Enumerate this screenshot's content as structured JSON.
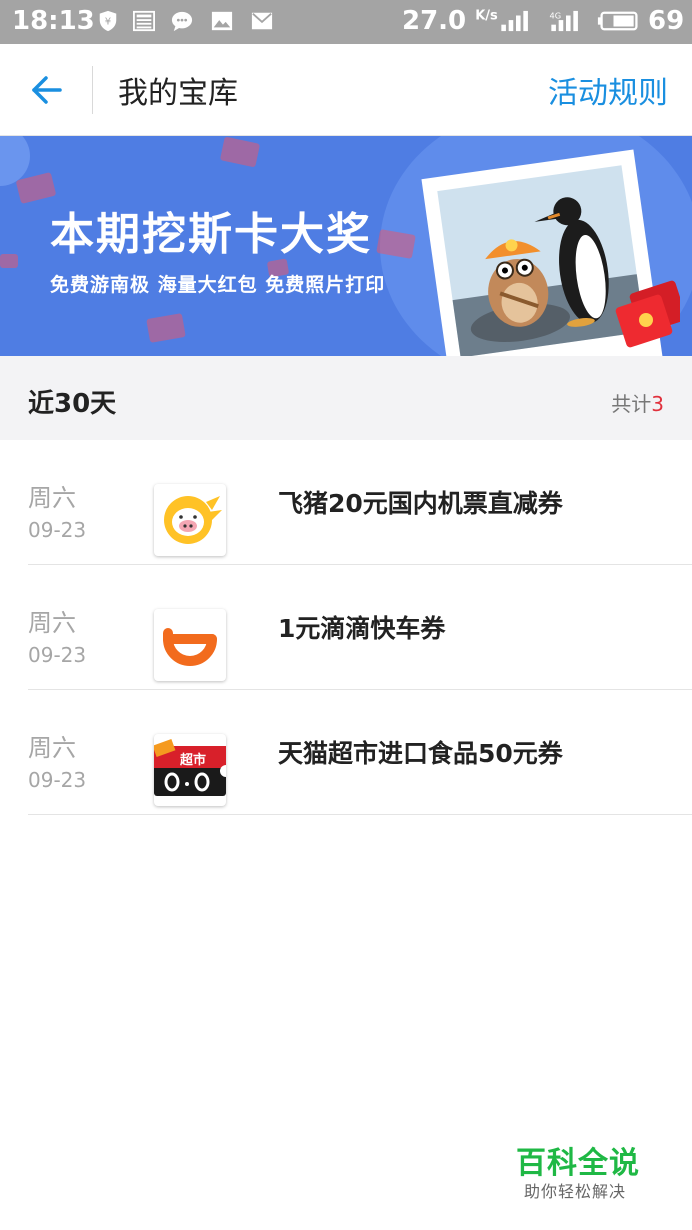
{
  "status_bar": {
    "time": "18:13",
    "net_speed": "27.0",
    "net_unit": "K/s",
    "battery": "69"
  },
  "header": {
    "title": "我的宝库",
    "rules_label": "活动规则"
  },
  "banner": {
    "title": "本期挖斯卡大奖",
    "subtitle": "免费游南极  海量大红包  免费照片打印"
  },
  "section": {
    "title": "近30天",
    "count_label": "共计",
    "count_value": "3"
  },
  "items": [
    {
      "weekday": "周六",
      "date": "09-23",
      "title": "飞猪20元国内机票直减券",
      "logo": "fliggy-icon"
    },
    {
      "weekday": "周六",
      "date": "09-23",
      "title": "1元滴滴快车券",
      "logo": "didi-icon"
    },
    {
      "weekday": "周六",
      "date": "09-23",
      "title": "天猫超市进口食品50元券",
      "logo": "tmall-supermarket-icon"
    }
  ],
  "watermark": {
    "title": "百科全说",
    "subtitle": "助你轻松解决"
  },
  "colors": {
    "accent": "#1a8fe0",
    "banner_bg": "#4f7de3",
    "count_highlight": "#e0303c",
    "watermark_green": "#1fb845"
  }
}
